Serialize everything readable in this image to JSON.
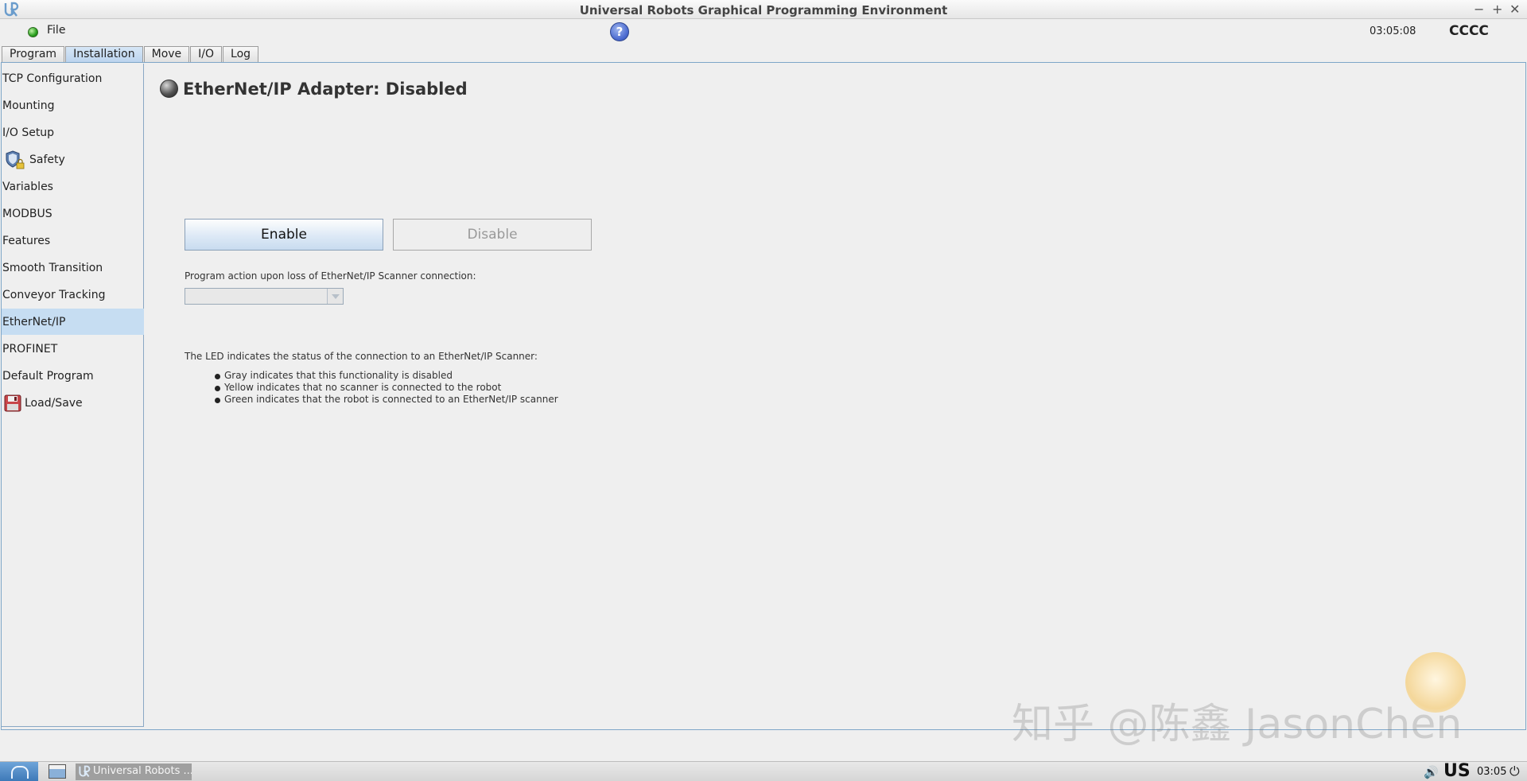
{
  "window": {
    "title": "Universal Robots Graphical Programming Environment",
    "minimize_glyph": "−",
    "maximize_glyph": "+",
    "close_glyph": "✕"
  },
  "menu": {
    "file_label": "File",
    "help_glyph": "?",
    "clock": "03:05:08",
    "robot_name": "CCCC"
  },
  "tabs": [
    {
      "label": "Program"
    },
    {
      "label": "Installation"
    },
    {
      "label": "Move"
    },
    {
      "label": "I/O"
    },
    {
      "label": "Log"
    }
  ],
  "sidebar": {
    "items": [
      {
        "label": "TCP Configuration"
      },
      {
        "label": "Mounting"
      },
      {
        "label": "I/O Setup"
      },
      {
        "label": "Safety"
      },
      {
        "label": "Variables"
      },
      {
        "label": "MODBUS"
      },
      {
        "label": "Features"
      },
      {
        "label": "Smooth Transition"
      },
      {
        "label": "Conveyor Tracking"
      },
      {
        "label": "EtherNet/IP"
      },
      {
        "label": "PROFINET"
      },
      {
        "label": "Default Program"
      },
      {
        "label": "Load/Save"
      }
    ]
  },
  "content": {
    "title": "EtherNet/IP Adapter: Disabled",
    "enable_label": "Enable",
    "disable_label": "Disable",
    "loss_action_label": "Program action upon loss of EtherNet/IP Scanner connection:",
    "loss_action_value": "",
    "led_intro": "The LED indicates the status of the connection to an EtherNet/IP Scanner:",
    "led_bullets": [
      "Gray indicates that this functionality is disabled",
      "Yellow indicates that no scanner is connected to the robot",
      "Green indicates that the robot is connected to an EtherNet/IP scanner"
    ]
  },
  "watermark": {
    "text": "知乎 @陈鑫 JasonChen"
  },
  "taskbar": {
    "window_label": "Universal Robots ...",
    "keyboard_layout": "US",
    "time": "03:05",
    "volume_glyph": "🔊",
    "power_glyph": "⏻"
  },
  "colors": {
    "active_tab": "#bcd4ee",
    "sidebar_selected": "#c6ddf2",
    "status_led_ok": "#29a01e",
    "adapter_led": "#555555"
  }
}
